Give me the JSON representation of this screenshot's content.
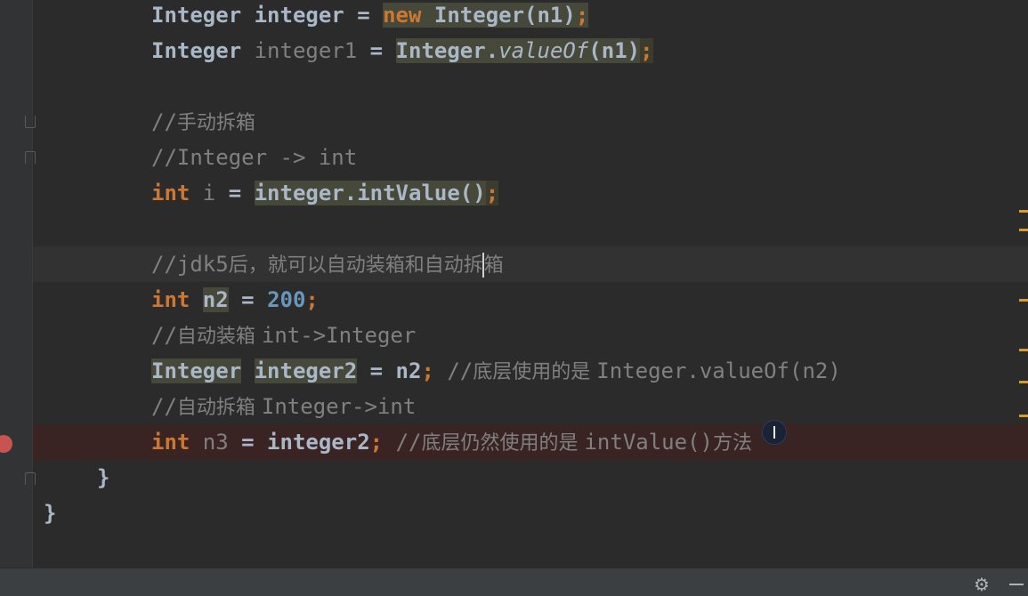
{
  "editor": {
    "lines": [
      {
        "name": "line-new-integer",
        "parts": [
          {
            "t": "Integer ",
            "c": ""
          },
          {
            "t": "integer ",
            "c": ""
          },
          {
            "t": "= ",
            "c": ""
          },
          {
            "t": "new ",
            "c": "kw hl2"
          },
          {
            "t": "Integer(n1)",
            "c": "hl2"
          },
          {
            "t": ";",
            "c": "kw hl2"
          }
        ]
      },
      {
        "name": "line-valueof",
        "parts": [
          {
            "t": "Integer ",
            "c": ""
          },
          {
            "t": "integer1 ",
            "c": "unused"
          },
          {
            "t": "= ",
            "c": ""
          },
          {
            "t": "Integer.",
            "c": "hl2"
          },
          {
            "t": "valueOf",
            "c": "it hl2"
          },
          {
            "t": "(n1)",
            "c": "hl2"
          },
          {
            "t": ";",
            "c": "kw hl"
          }
        ]
      },
      {
        "name": "line-blank-1",
        "parts": []
      },
      {
        "name": "line-comment-manual-unbox",
        "parts": [
          {
            "t": "//",
            "c": "comment"
          },
          {
            "t": "手动拆箱",
            "c": "comment cjk"
          }
        ]
      },
      {
        "name": "line-comment-integer-to-int",
        "parts": [
          {
            "t": "//Integer -> int",
            "c": "comment"
          }
        ]
      },
      {
        "name": "line-intvalue",
        "parts": [
          {
            "t": "int ",
            "c": "kw"
          },
          {
            "t": "i ",
            "c": "unused"
          },
          {
            "t": "= ",
            "c": ""
          },
          {
            "t": "integer.intValue()",
            "c": "hl2"
          },
          {
            "t": ";",
            "c": "kw hl"
          }
        ]
      },
      {
        "name": "line-blank-2",
        "parts": []
      },
      {
        "name": "line-comment-jdk5",
        "parts": [
          {
            "t": "//jdk5",
            "c": "comment"
          },
          {
            "t": "后，就可以自动装箱和自动拆",
            "c": "comment cjk"
          },
          {
            "t": "",
            "c": "caret"
          },
          {
            "t": "箱",
            "c": "comment cjk"
          }
        ]
      },
      {
        "name": "line-n2",
        "parts": [
          {
            "t": "int ",
            "c": "kw"
          },
          {
            "t": "n2",
            "c": "hl2"
          },
          {
            "t": " = ",
            "c": ""
          },
          {
            "t": "200",
            "c": "num"
          },
          {
            "t": ";",
            "c": "kw"
          }
        ]
      },
      {
        "name": "line-comment-autobox",
        "parts": [
          {
            "t": "//",
            "c": "comment"
          },
          {
            "t": "自动装箱 ",
            "c": "comment cjk"
          },
          {
            "t": "int->Integer",
            "c": "comment"
          }
        ]
      },
      {
        "name": "line-integer2",
        "parts": [
          {
            "t": "Integer",
            "c": "hl2"
          },
          {
            "t": " ",
            "c": ""
          },
          {
            "t": "integer2",
            "c": "hl2"
          },
          {
            "t": " = n2",
            "c": ""
          },
          {
            "t": "; ",
            "c": "kw"
          },
          {
            "t": "//",
            "c": "comment"
          },
          {
            "t": "底层使用的是 ",
            "c": "comment cjk"
          },
          {
            "t": "Integer.valueOf(n2)",
            "c": "comment"
          }
        ]
      },
      {
        "name": "line-comment-autounbox",
        "parts": [
          {
            "t": "//",
            "c": "comment"
          },
          {
            "t": "自动拆箱 ",
            "c": "comment cjk"
          },
          {
            "t": "Integer->int",
            "c": "comment"
          }
        ]
      },
      {
        "name": "line-n3",
        "parts": [
          {
            "t": "int ",
            "c": "kw"
          },
          {
            "t": "n3 ",
            "c": "unused"
          },
          {
            "t": "= integer2",
            "c": ""
          },
          {
            "t": "; ",
            "c": "kw"
          },
          {
            "t": "//",
            "c": "comment"
          },
          {
            "t": "底层仍然使用的是 ",
            "c": "comment cjk"
          },
          {
            "t": "intValue()",
            "c": "comment"
          },
          {
            "t": "方法",
            "c": "comment cjk"
          }
        ]
      },
      {
        "name": "line-close-method",
        "parts": [
          {
            "t": "}",
            "c": ""
          }
        ]
      },
      {
        "name": "line-close-class",
        "parts": [
          {
            "t": "}",
            "c": ""
          }
        ]
      }
    ]
  },
  "icons": {
    "gear": "gear-icon",
    "minimize": "minimize-icon",
    "bulb": "lightbulb-icon",
    "breakpoint": "breakpoint-icon"
  },
  "colors": {
    "keyword": "#cc7832",
    "number": "#6897bb",
    "comment": "#808080",
    "text": "#a9b7c6",
    "breakpoint": "#c75450"
  }
}
